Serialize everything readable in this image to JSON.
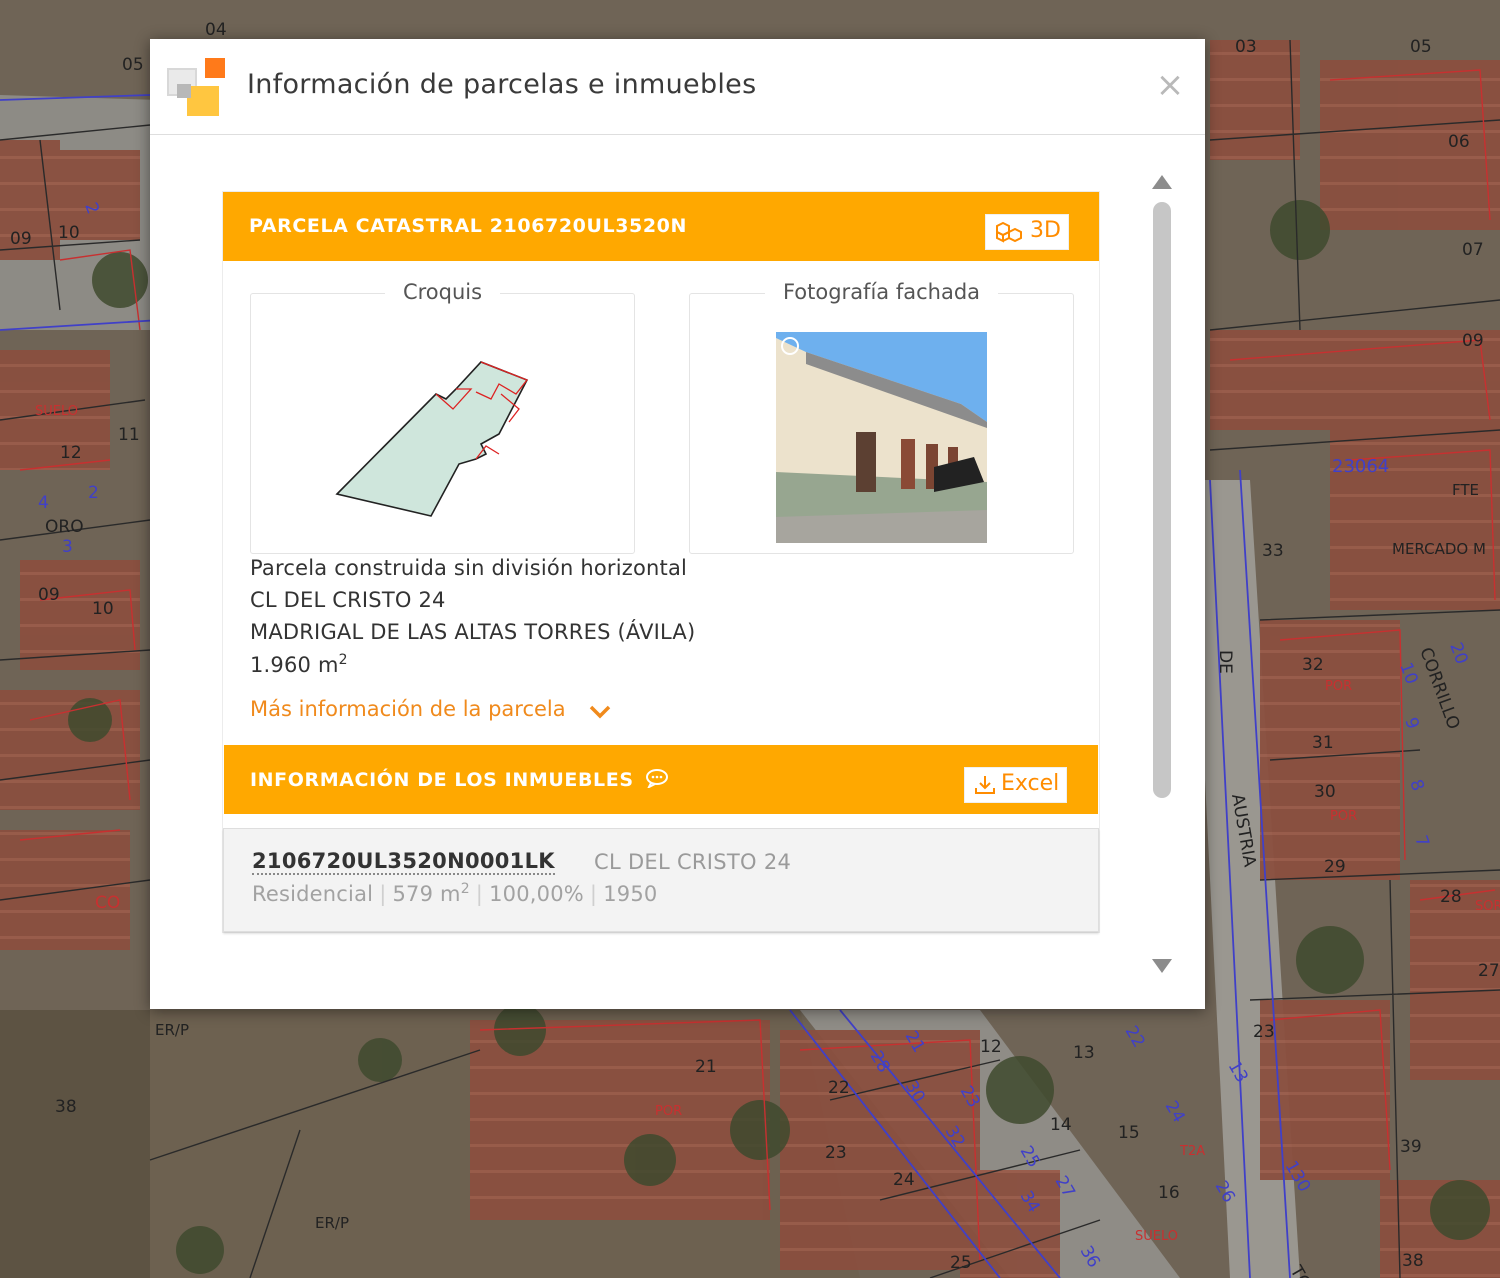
{
  "modal": {
    "title": "Información de parcelas e inmuebles",
    "close_label": "×"
  },
  "parcel": {
    "header": "PARCELA CATASTRAL 2106720UL3520N",
    "button_3d": "3D",
    "sketch_title": "Croquis",
    "photo_title": "Fotografía fachada",
    "type": "Parcela construida sin división horizontal",
    "address": "CL DEL CRISTO 24",
    "municipality": "MADRIGAL DE LAS ALTAS TORRES (ÁVILA)",
    "area_value": "1.960 m",
    "area_sup": "2",
    "more_info": "Más información de la parcela"
  },
  "properties": {
    "header": "INFORMACIÓN DE LOS INMUEBLES",
    "excel_label": "Excel",
    "items": [
      {
        "reference": "2106720UL3520N0001LK",
        "address": "CL DEL CRISTO 24",
        "use": "Residencial",
        "area_value": "579 m",
        "area_sup": "2",
        "share": "100,00%",
        "year": "1950"
      }
    ]
  },
  "map_labels": [
    "04",
    "05",
    "03",
    "05",
    "06",
    "07",
    "09",
    "09",
    "10",
    "2",
    "SUELO",
    "11",
    "12",
    "4",
    "2",
    "ORO",
    "3",
    "09",
    "10",
    "33",
    "MERCADO M",
    "FTE",
    "23064",
    "32",
    "31",
    "30",
    "29",
    "28",
    "27",
    "DE",
    "AUSTRIA",
    "CORRILLO",
    "20",
    "10",
    "9",
    "8",
    "7",
    "ER/P",
    "SUELO",
    "38",
    "ER/P",
    "21",
    "22",
    "23",
    "24",
    "12",
    "13",
    "14",
    "15",
    "16",
    "18",
    "25",
    "26",
    "27",
    "28",
    "29",
    "30",
    "32",
    "34",
    "36",
    "39",
    "38",
    "13",
    "130",
    "23",
    "TOR",
    "CO",
    "SOR",
    "POR",
    "T2A"
  ],
  "colors": {
    "accent_orange": "#ffa800",
    "link_orange": "#f08a1c",
    "parcel_fill": "#cfe6dc"
  },
  "icons": {
    "logo": "catastro-logo-icon",
    "close": "close-icon",
    "cube": "cubes-3d-icon",
    "download": "download-icon",
    "comment": "comment-icon",
    "chevron": "chevron-down-icon"
  }
}
